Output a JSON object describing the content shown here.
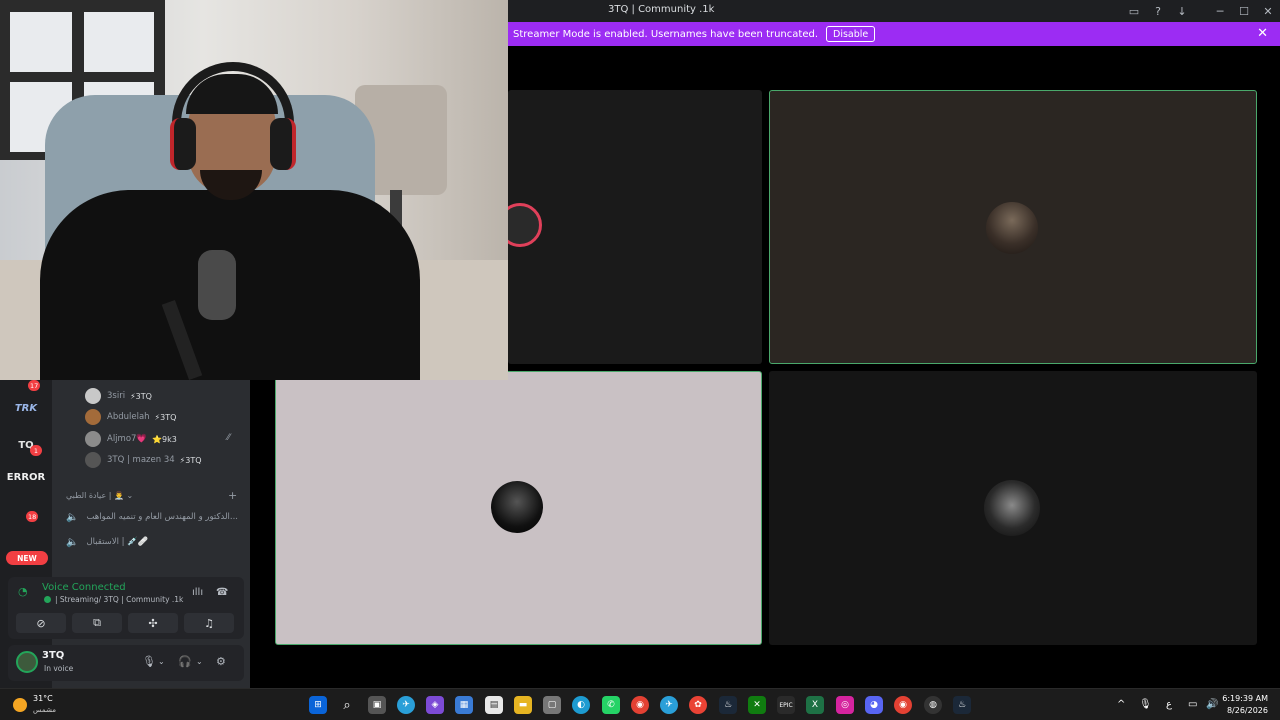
{
  "window": {
    "title": "3TQ | Community .1k"
  },
  "banner": {
    "text": "Streamer Mode is enabled. Usernames have been truncated.",
    "button": "Disable",
    "color": "#9c2cf3"
  },
  "guilds": [
    {
      "label": "TRK",
      "badge": ""
    },
    {
      "label": "TQ",
      "badge": "1"
    },
    {
      "label": "ERROR",
      "badge": ""
    },
    {
      "label": "",
      "badge": "18"
    },
    {
      "label": "",
      "badge": "17"
    }
  ],
  "guild_new": "NEW",
  "members": [
    {
      "name": "3siri",
      "tag": "⚡3TQ"
    },
    {
      "name": "Abdulelah",
      "tag": "⚡3TQ"
    },
    {
      "name": "Aljmo7💗",
      "tag": "⭐9k3"
    },
    {
      "name": "3TQ | mazen 34",
      "tag": "⚡3TQ"
    }
  ],
  "category": "عيادة الطبي | 👨‍⚕️",
  "channels": [
    {
      "label": "الدكتور و المهندس العام و تنميه المواهب..."
    },
    {
      "label": "الاستقبال | 💉🩹"
    }
  ],
  "voice": {
    "title": "Voice Connected",
    "subtitle": "| Streaming/ 3TQ | Community .1k",
    "accent": "#23a55a"
  },
  "user": {
    "name": "3TQ",
    "status": "In voice"
  },
  "taskbar": {
    "temp": "31°C",
    "condition": "مشمس",
    "time": "6:19:39 AM",
    "date": "8/26/2026",
    "lang": "ع"
  }
}
